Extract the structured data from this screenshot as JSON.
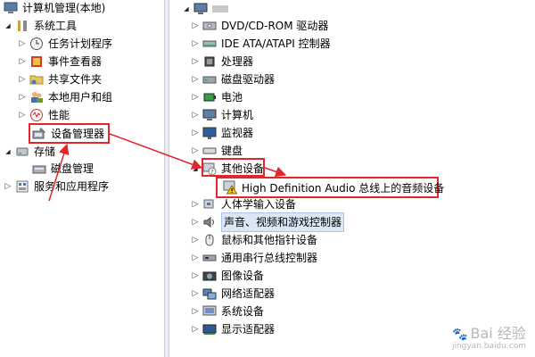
{
  "left_tree": {
    "root_label": "计算机管理(本地)",
    "system_tools": "系统工具",
    "task_scheduler": "任务计划程序",
    "event_viewer": "事件查看器",
    "shared_folders": "共享文件夹",
    "local_users": "本地用户和组",
    "performance": "性能",
    "device_manager": "设备管理器",
    "storage": "存储",
    "disk_management": "磁盘管理",
    "services_apps": "服务和应用程序"
  },
  "right_tree": {
    "computer_name": "",
    "items": [
      {
        "label": "DVD/CD-ROM 驱动器",
        "icon": "dvd-drive-icon"
      },
      {
        "label": "IDE ATA/ATAPI 控制器",
        "icon": "ide-controller-icon"
      },
      {
        "label": "处理器",
        "icon": "processor-icon"
      },
      {
        "label": "磁盘驱动器",
        "icon": "disk-drive-icon"
      },
      {
        "label": "电池",
        "icon": "battery-icon"
      },
      {
        "label": "计算机",
        "icon": "computer-icon"
      },
      {
        "label": "监视器",
        "icon": "monitor-icon"
      },
      {
        "label": "键盘",
        "icon": "keyboard-icon"
      },
      {
        "label": "其他设备",
        "icon": "other-devices-icon"
      }
    ],
    "child_device": "High Definition Audio 总线上的音频设备",
    "items_after": [
      {
        "label": "人体学输入设备",
        "icon": "hid-icon"
      },
      {
        "label": "声音、视频和游戏控制器",
        "icon": "sound-icon"
      },
      {
        "label": "鼠标和其他指针设备",
        "icon": "mouse-icon"
      },
      {
        "label": "通用串行总线控制器",
        "icon": "usb-icon"
      },
      {
        "label": "图像设备",
        "icon": "camera-icon"
      },
      {
        "label": "网络适配器",
        "icon": "network-adapter-icon"
      },
      {
        "label": "系统设备",
        "icon": "system-devices-icon"
      },
      {
        "label": "显示适配器",
        "icon": "display-adapter-icon"
      }
    ]
  },
  "watermark": {
    "text": "Bai 经验",
    "url": "jingyan.baidu.com"
  },
  "colors": {
    "annotation": "#e2262b",
    "selection": "#dbe7f5"
  }
}
